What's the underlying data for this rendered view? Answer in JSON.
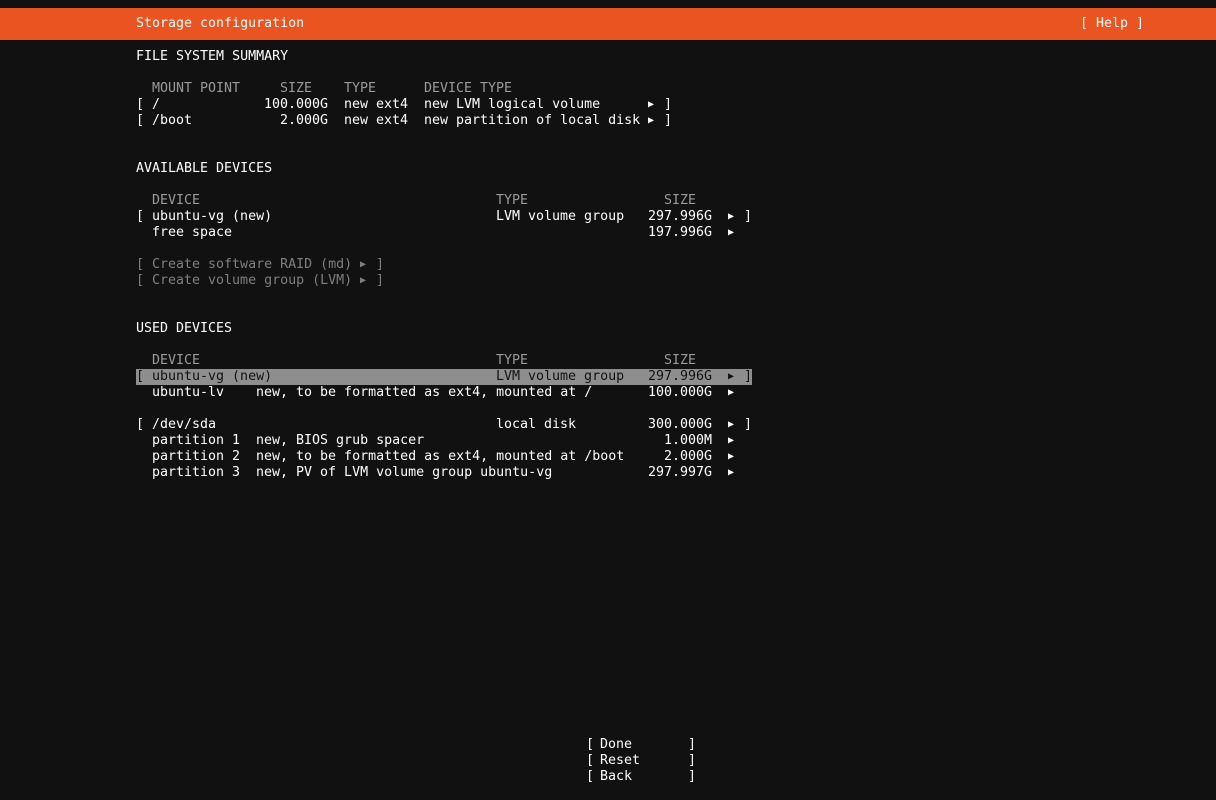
{
  "header": {
    "title": "Storage configuration",
    "help": "[ Help ]"
  },
  "fs_summary": {
    "heading": "FILE SYSTEM SUMMARY",
    "columns": [
      "MOUNT POINT",
      "SIZE",
      "TYPE",
      "DEVICE TYPE"
    ],
    "rows": [
      {
        "mount": "/",
        "size": "100.000G",
        "type": "new ext4",
        "device_type": "new LVM logical volume"
      },
      {
        "mount": "/boot",
        "size": "2.000G",
        "type": "new ext4",
        "device_type": "new partition of local disk"
      }
    ]
  },
  "available": {
    "heading": "AVAILABLE DEVICES",
    "columns": [
      "DEVICE",
      "TYPE",
      "SIZE"
    ],
    "rows": [
      {
        "device": "ubuntu-vg (new)",
        "type": "LVM volume group",
        "size": "297.996G"
      },
      {
        "device": "free space",
        "type": "",
        "size": "197.996G"
      }
    ],
    "actions": [
      "Create software RAID (md)",
      "Create volume group (LVM)"
    ]
  },
  "used": {
    "heading": "USED DEVICES",
    "columns": [
      "DEVICE",
      "TYPE",
      "SIZE"
    ],
    "groups": [
      {
        "device": "ubuntu-vg (new)",
        "type": "LVM volume group",
        "size": "297.996G",
        "children": [
          {
            "name": "ubuntu-lv",
            "desc": "new, to be formatted as ext4, mounted at /",
            "size": "100.000G"
          }
        ]
      },
      {
        "device": "/dev/sda",
        "type": "local disk",
        "size": "300.000G",
        "children": [
          {
            "name": "partition 1",
            "desc": "new, BIOS grub spacer",
            "size": "1.000M"
          },
          {
            "name": "partition 2",
            "desc": "new, to be formatted as ext4, mounted at /boot",
            "size": "2.000G"
          },
          {
            "name": "partition 3",
            "desc": "new, PV of LVM volume group ubuntu-vg",
            "size": "297.997G"
          }
        ]
      }
    ]
  },
  "buttons": [
    "Done",
    "Reset",
    "Back"
  ],
  "glyphs": {
    "open": "[",
    "close": "]",
    "arrow": "▶"
  },
  "colors": {
    "accent": "#e95420",
    "background": "#111111",
    "selection": "#8e8e8e",
    "disabled": "#7f7f7f"
  }
}
